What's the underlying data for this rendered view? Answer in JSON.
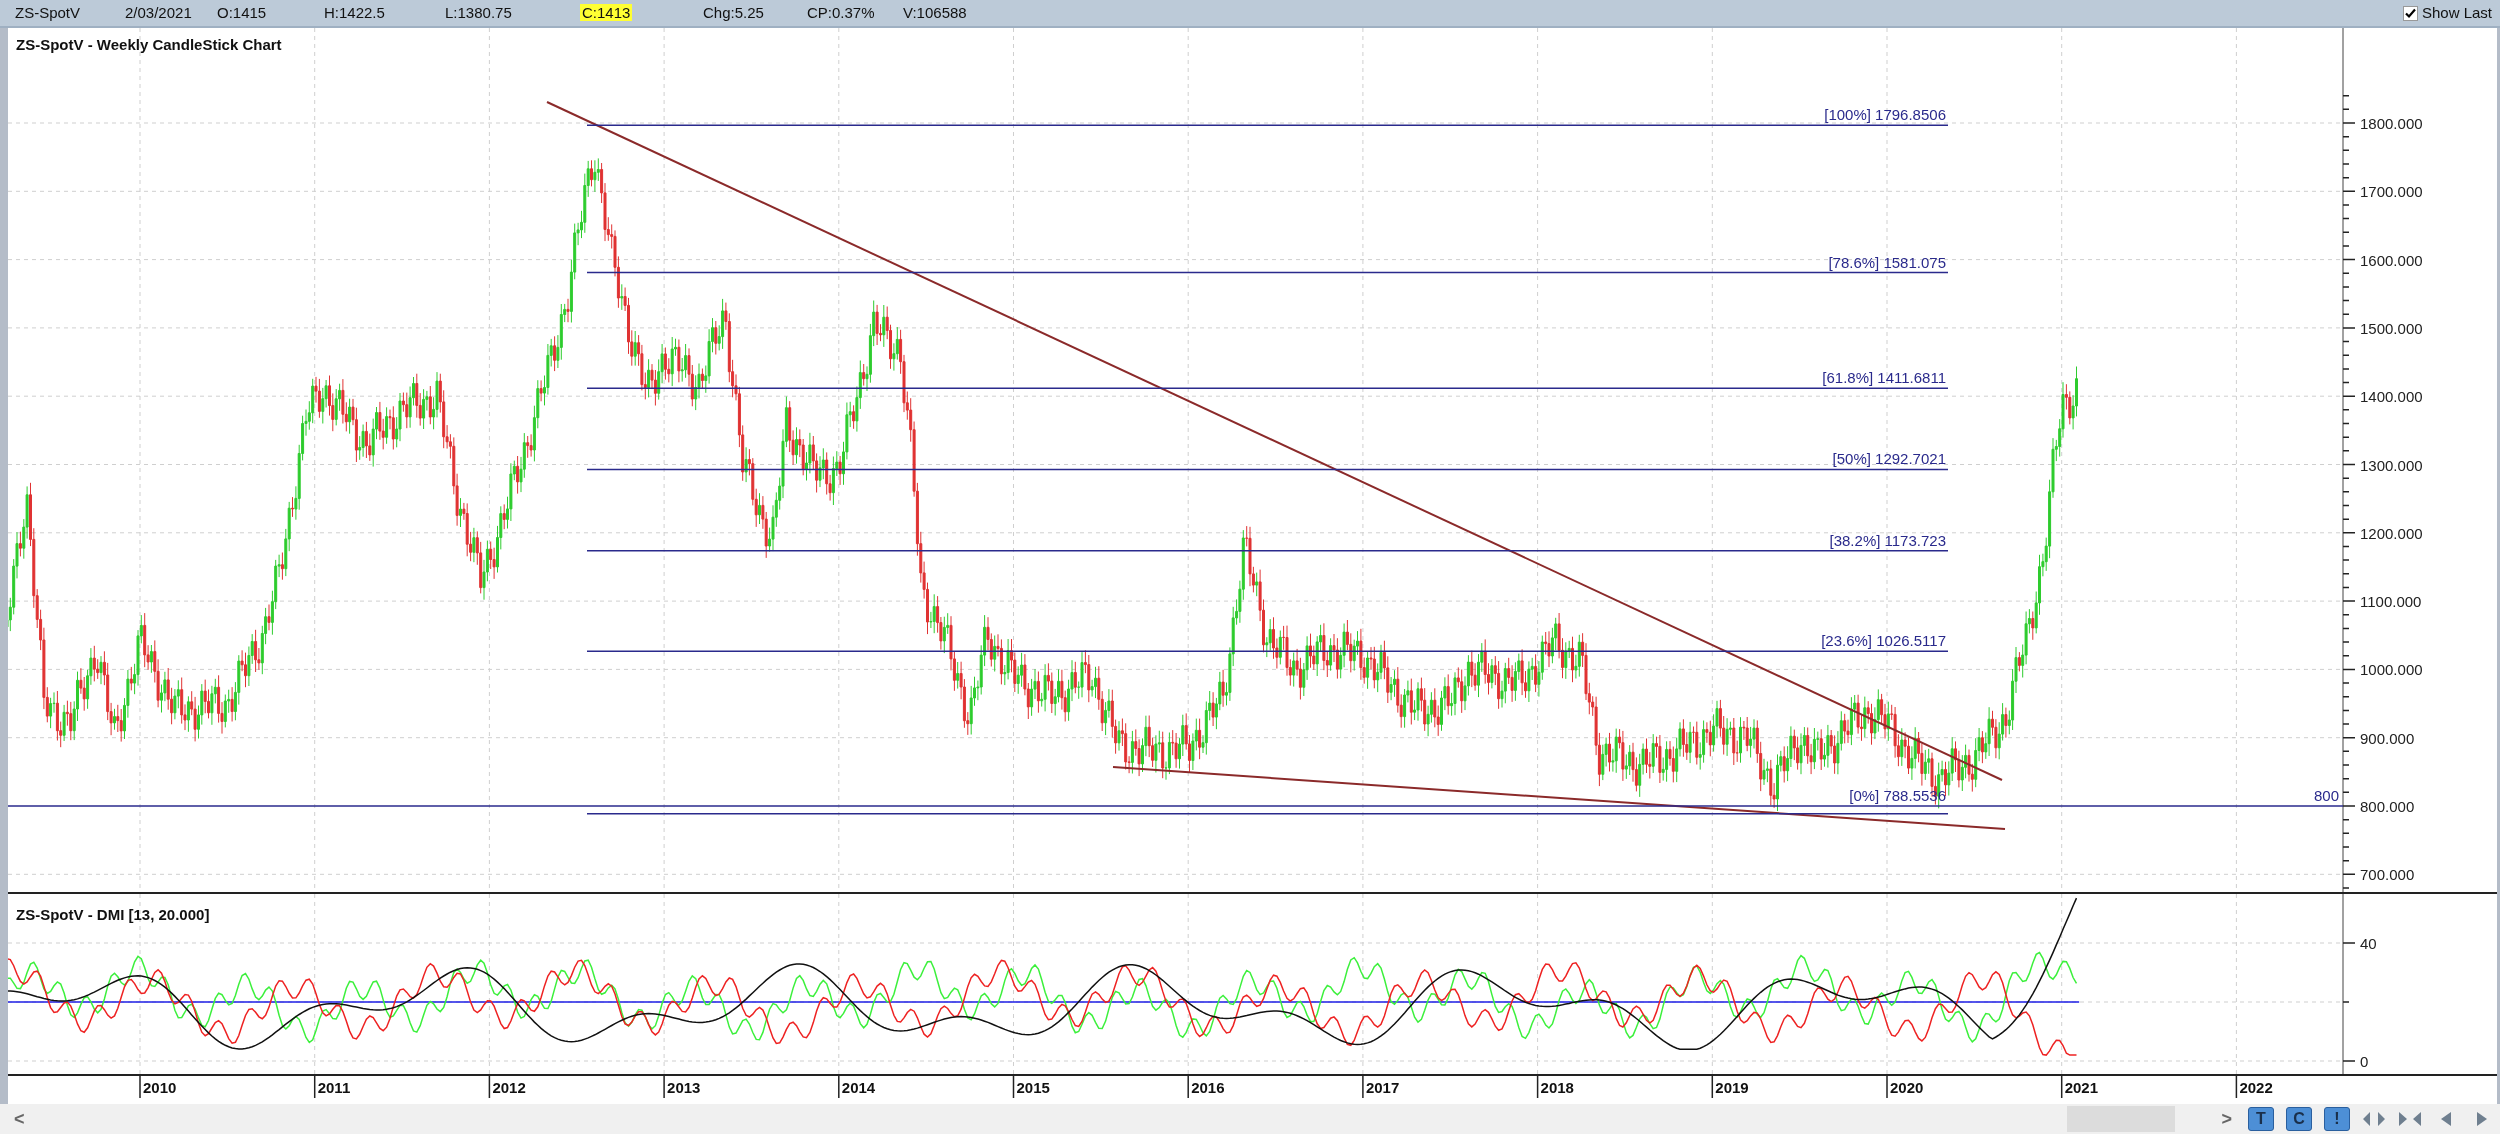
{
  "quote_bar": {
    "fields": [
      {
        "text": "ZS-SpotV",
        "highlighted": false
      },
      {
        "text": "2/03/2021",
        "highlighted": false
      },
      {
        "text": "O:1415",
        "highlighted": false
      },
      {
        "text": "H:1422.5",
        "highlighted": false
      },
      {
        "text": "L:1380.75",
        "highlighted": false
      },
      {
        "text": "C:1413",
        "highlighted": true
      },
      {
        "text": "Chg:5.25",
        "highlighted": false
      },
      {
        "text": "CP:0.37%",
        "highlighted": false
      },
      {
        "text": "V:106588",
        "highlighted": false
      }
    ],
    "show_last": {
      "label": "Show Last",
      "checked": true
    }
  },
  "price_panel": {
    "title": "ZS-SpotV - Weekly CandleStick Chart",
    "y_axis_labels": [
      "1800.000",
      "1700.000",
      "1600.000",
      "1500.000",
      "1400.000",
      "1300.000",
      "1200.000",
      "1100.000",
      "1000.000",
      "900.000",
      "800.000",
      "700.000"
    ],
    "fib_levels": [
      {
        "label": "[100%] 1796.8506"
      },
      {
        "label": "[78.6%] 1581.075"
      },
      {
        "label": "[61.8%] 1411.6811"
      },
      {
        "label": "[50%] 1292.7021"
      },
      {
        "label": "[38.2%] 1173.723"
      },
      {
        "label": "[23.6%] 1026.5117"
      },
      {
        "label": "[0%] 788.5536"
      }
    ],
    "horizontal_line_label": "800"
  },
  "dmi_panel": {
    "title": "ZS-SpotV - DMI [13, 20.000]",
    "y_axis_labels": [
      "40",
      "0"
    ]
  },
  "x_axis_labels": [
    "2010",
    "2011",
    "2012",
    "2013",
    "2014",
    "2015",
    "2016",
    "2017",
    "2018",
    "2019",
    "2020",
    "2021",
    "2022"
  ],
  "scroll_bar": {
    "left_arrow": "<",
    "right_arrow": ">",
    "buttons": [
      "T",
      "C",
      "!"
    ]
  }
}
